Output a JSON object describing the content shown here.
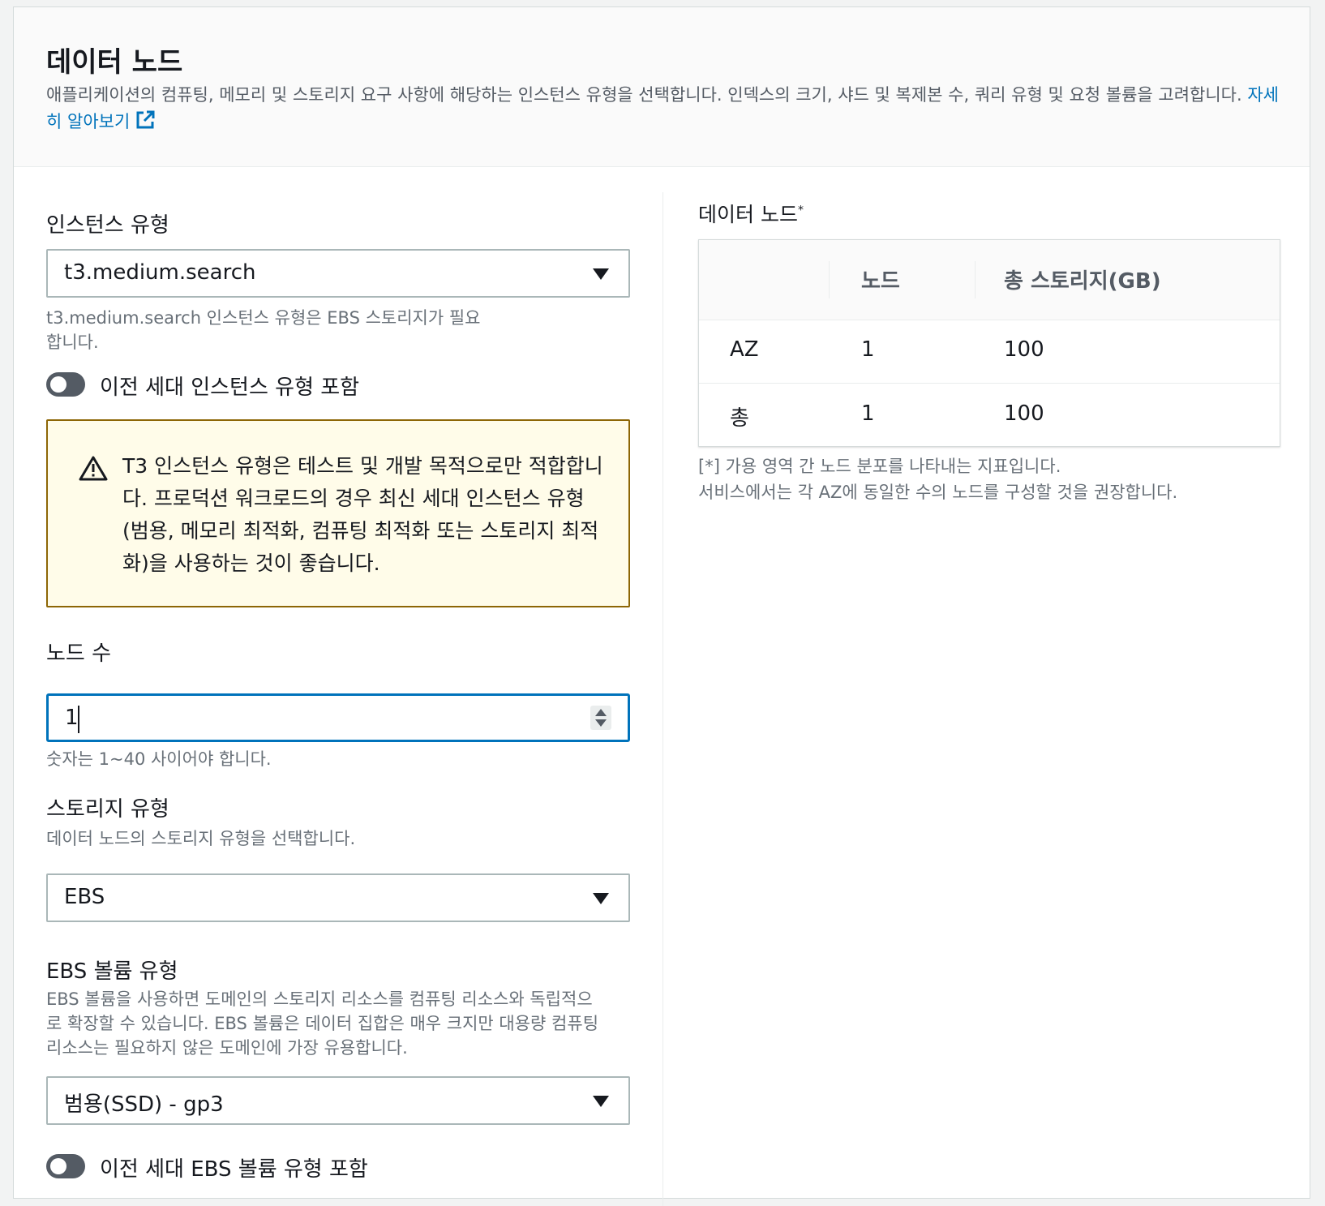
{
  "header": {
    "title": "데이터 노드",
    "description": "애플리케이션의 컴퓨팅, 메모리 및 스토리지 요구 사항에 해당하는 인스턴스 유형을 선택합니다. 인덱스의 크기, 샤드 및 복제본 수, 쿼리 유형 및 요청 볼륨을 고려합니다.",
    "learn_more": "자세히 알아보기",
    "learn_more_icon": "external-link-icon"
  },
  "instance_type": {
    "label": "인스턴스 유형",
    "value": "t3.medium.search",
    "hint_line1": "t3.medium.search 인스턴스 유형은 EBS 스토리지가 필요",
    "hint_line2": "합니다.",
    "toggle_label": "이전 세대 인스턴스 유형 포함",
    "toggle_on": false
  },
  "alert": {
    "icon": "warning-icon",
    "text": "T3 인스턴스 유형은 테스트 및 개발 목적으로만 적합합니다. 프로덕션 워크로드의 경우 최신 세대 인스턴스 유형(범용, 메모리 최적화, 컴퓨팅 최적화 또는 스토리지 최적화)을 사용하는 것이 좋습니다."
  },
  "node_count": {
    "label": "노드 수",
    "value": "1",
    "hint": "숫자는 1~40 사이어야 합니다."
  },
  "storage_type": {
    "label": "스토리지 유형",
    "description": "데이터 노드의 스토리지 유형을 선택합니다.",
    "value": "EBS"
  },
  "ebs_volume": {
    "label": "EBS 볼륨 유형",
    "description_line1": "EBS 볼륨을 사용하면 도메인의 스토리지 리소스를 컴퓨팅 리소스와 독립적으",
    "description_line2": "로 확장할 수 있습니다. EBS 볼륨은 데이터 집합은 매우 크지만 대용량 컴퓨팅",
    "description_line3": "리소스는 필요하지 않은 도메인에 가장 유용합니다.",
    "value": "범용(SSD) - gp3",
    "toggle_label": "이전 세대 EBS 볼륨 유형 포함",
    "toggle_on": false
  },
  "summary": {
    "title": "데이터 노드",
    "title_marker": "*",
    "columns": [
      "",
      "노드",
      "총 스토리지(GB)"
    ],
    "rows": [
      [
        "AZ",
        "1",
        "100"
      ],
      [
        "총",
        "1",
        "100"
      ]
    ],
    "footnote_line1": "[*] 가용 영역 간 노드 분포를 나타내는 지표입니다.",
    "footnote_line2": "서비스에서는 각 AZ에 동일한 수의 노드를 구성할 것을 권장합니다."
  }
}
